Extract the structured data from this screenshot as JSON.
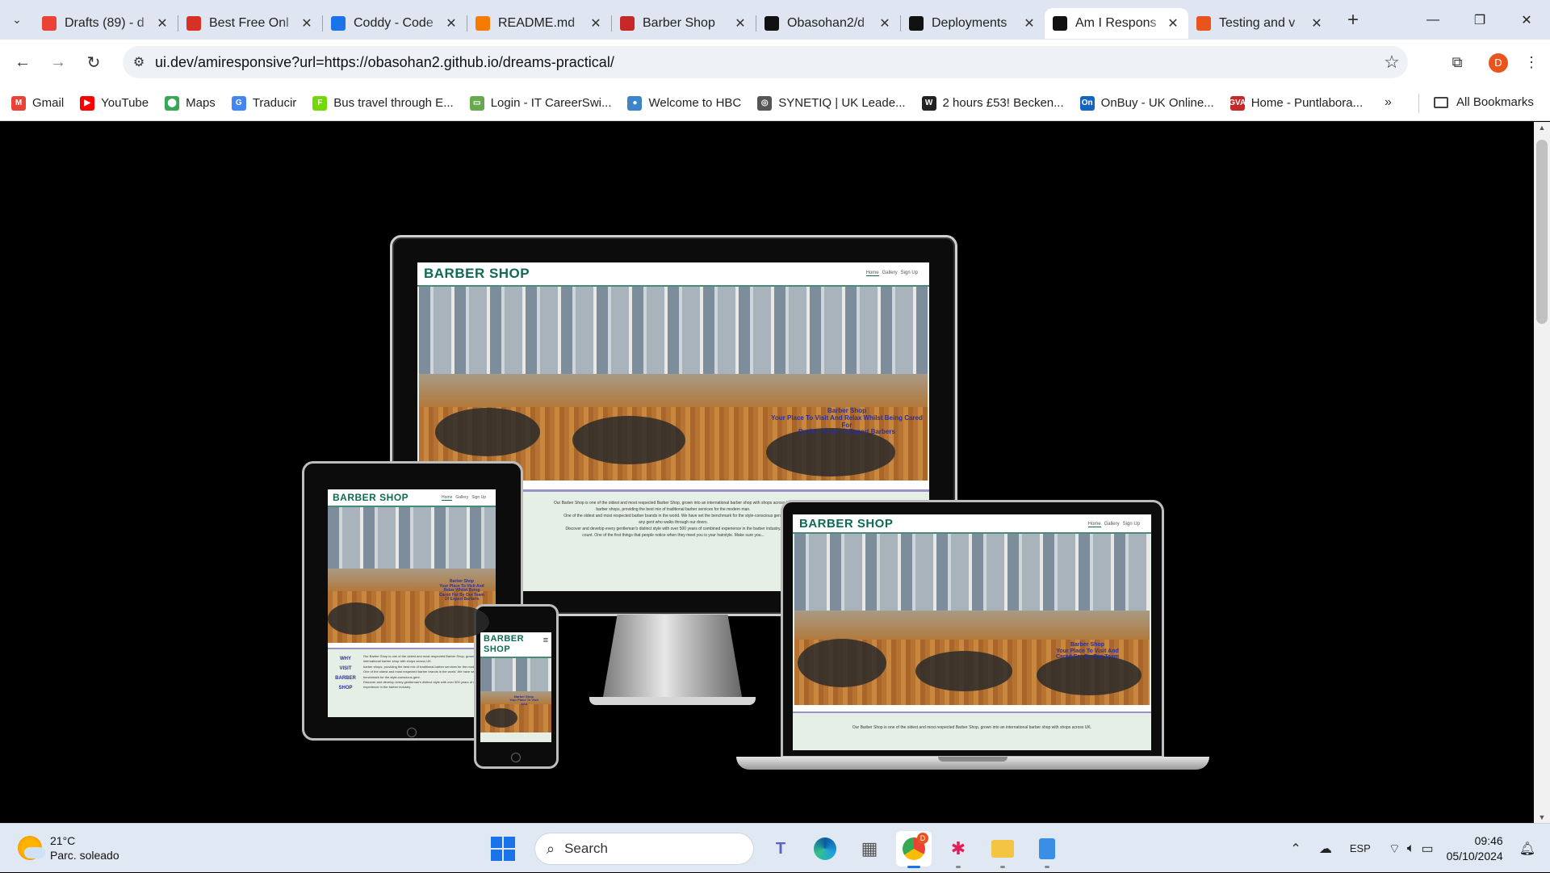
{
  "browser": {
    "tabs": [
      {
        "title": "Drafts (89) - d",
        "icon": "gmail-icon",
        "color": "#ea4335",
        "active": false
      },
      {
        "title": "Best Free Onl",
        "icon": "site-icon",
        "color": "#d93025",
        "active": false
      },
      {
        "title": "Coddy - Code",
        "icon": "coddy-icon",
        "color": "#1a73e8",
        "active": false
      },
      {
        "title": "README.md",
        "icon": "gitpod-icon",
        "color": "#f57c00",
        "active": false
      },
      {
        "title": "Barber Shop",
        "icon": "bs-icon",
        "color": "#c62828",
        "active": false
      },
      {
        "title": "Obasohan2/d",
        "icon": "github-icon",
        "color": "#111111",
        "active": false
      },
      {
        "title": "Deployments",
        "icon": "github-icon",
        "color": "#111111",
        "active": false
      },
      {
        "title": "Am I Respons",
        "icon": "ui-icon",
        "color": "#111111",
        "active": true
      },
      {
        "title": "Testing and v",
        "icon": "testing-icon",
        "color": "#e8541c",
        "active": false
      }
    ],
    "url": "ui.dev/amiresponsive?url=https://obasohan2.github.io/dreams-practical/",
    "profile_initial": "D",
    "bookmarks": [
      {
        "label": "Gmail",
        "color": "#ea4335",
        "glyph": "M"
      },
      {
        "label": "YouTube",
        "color": "#ff0000",
        "glyph": "▶"
      },
      {
        "label": "Maps",
        "color": "#34a853",
        "glyph": "⬤"
      },
      {
        "label": "Traducir",
        "color": "#4285f4",
        "glyph": "G"
      },
      {
        "label": "Bus travel through E...",
        "color": "#73d700",
        "glyph": "F"
      },
      {
        "label": "Login - IT CareerSwi...",
        "color": "#6aa84f",
        "glyph": "▭"
      },
      {
        "label": "Welcome to HBC",
        "color": "#3d85c6",
        "glyph": "●"
      },
      {
        "label": "SYNETIQ | UK Leade...",
        "color": "#555555",
        "glyph": "◎"
      },
      {
        "label": "2 hours £53! Becken...",
        "color": "#222222",
        "glyph": "W"
      },
      {
        "label": "OnBuy - UK Online...",
        "color": "#1565c0",
        "glyph": "On"
      },
      {
        "label": "Home - Puntlabora...",
        "color": "#c62828",
        "glyph": "GVA"
      }
    ],
    "all_bookmarks": "All Bookmarks"
  },
  "mockup": {
    "site_title": "BARBER SHOP",
    "site_title_wrapped": [
      "BARBER",
      "SHOP"
    ],
    "nav": [
      "Home",
      "Gallery",
      "Sign Up"
    ],
    "hero_caption": [
      "Barber Shop",
      "Your Place To Visit And Relax Whilst Being Cared For",
      "By Our Team Of Expert Barbers"
    ],
    "tablet_caption": [
      "Barber Shop",
      "Your Place To Visit And",
      "Relax Whilst Being",
      "Cared For By Our Team",
      "Of Expert Barbers"
    ],
    "why_heading": [
      "WHY",
      "VISIT",
      "BARBER",
      "SHOP"
    ],
    "body_text": [
      "Our Barber Shop is one of the oldest and most respected Barber Shop, grown into an international barber shop with shops across UK.",
      "barber shops, providing the best mix of traditional barber services for the modern man.",
      "One of the oldest and most respected barber brands in the world. We have set the benchmark for the style-conscious gent.",
      "any gent who walks through our doors.",
      "Discover and develop every gentleman's distinct style with over 500 years of combined experience in the barber industry.",
      "count. One of the first things that people notice when they meet you is your hairstyle. Make sure you..."
    ]
  },
  "taskbar": {
    "temperature": "21°C",
    "weather": "Parc. soleado",
    "search_placeholder": "Search",
    "language": "ESP",
    "time": "09:46",
    "date": "05/10/2024",
    "chrome_badge": "D"
  }
}
